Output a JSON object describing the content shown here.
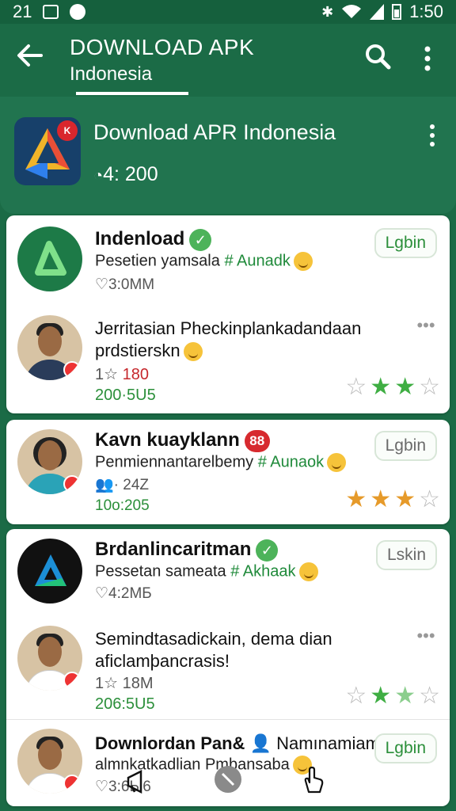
{
  "status": {
    "time_left": "21",
    "time_right": "1:50"
  },
  "appbar": {
    "title": "DOWNLOAD APK",
    "subtitle": "Indonesia"
  },
  "header": {
    "title": "Download APR Indonesia",
    "meta": "4: 200"
  },
  "cards": [
    {
      "items": [
        {
          "name": "Indenload",
          "badge": "verified",
          "line1": "Pesetien yamsala",
          "hashtag": "# Aunadk",
          "meta": "3:0MM",
          "button": "Lgbin"
        },
        {
          "name": "Jerritasian Pheckinplankadandaan",
          "line1": "prdstierskn",
          "meta1": "1",
          "meta1_red": "180",
          "meta2": "200·5U5",
          "stars": [
            "empty",
            "green",
            "green",
            "empty"
          ]
        }
      ]
    },
    {
      "items": [
        {
          "name": "Kavn kuayklann",
          "badge": "88",
          "line1": "Penmiennantarelbemy",
          "hashtag": "# Aunaok",
          "meta1": "· 24Z",
          "meta2": "10o:205",
          "button": "Lgbin",
          "stars": [
            "orange",
            "orange",
            "orange",
            "empty"
          ]
        }
      ]
    },
    {
      "items": [
        {
          "name": "Brdanlincaritman",
          "badge": "verified",
          "line1": "Pessetan sameata",
          "hashtag": "# Akhaak",
          "meta": "4:2MБ",
          "button": "Lskin"
        },
        {
          "name": "Semindtasadickain, dema dian",
          "line1": "aficlamþancrasis!",
          "meta1": "1",
          "meta1_b": "18M",
          "meta2": "206:5U5",
          "stars": [
            "empty",
            "green",
            "green",
            "empty"
          ]
        },
        {
          "name": "Downlordan Pan&",
          "name2": "Namınamiam,",
          "line1": "almnkatkadlian Pmbansaba",
          "meta": "3:6Ы6",
          "button": "Lgbin"
        }
      ]
    }
  ],
  "colors": {
    "primary": "#1b6b46",
    "accent_green": "#3fae43",
    "star_orange": "#e69a2a",
    "badge_red": "#d72a2f"
  },
  "icons": [
    "back-arrow-icon",
    "search-icon",
    "more-vert-icon",
    "verified-icon",
    "star-icon",
    "heart-icon",
    "emoji-icon"
  ]
}
